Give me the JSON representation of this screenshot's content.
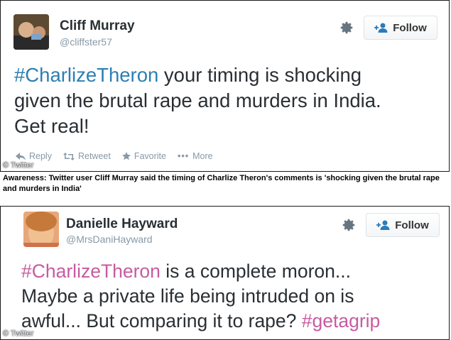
{
  "tweet1": {
    "name": "Cliff Murray",
    "handle": "@cliffster57",
    "follow_label": "Follow",
    "hashtag": "#CharlizeTheron",
    "text_line1_rest": " your timing is shocking",
    "text_line2": "given the brutal rape and murders in India.",
    "text_line3": "Get real!",
    "actions": {
      "reply": "Reply",
      "retweet": "Retweet",
      "favorite": "Favorite",
      "more": "More"
    },
    "credit": "© Twitter"
  },
  "caption": "Awareness: Twitter user Cliff Murray said the timing of Charlize Theron's comments is 'shocking given the brutal rape and murders in India'",
  "tweet2": {
    "name": "Danielle Hayward",
    "handle": "@MrsDaniHayward",
    "follow_label": "Follow",
    "hashtag": "#CharlizeTheron",
    "text_line1_rest": " is a complete moron...",
    "text_line2": "Maybe a private life being intruded on is",
    "text_line3_start": "awful... But comparing it to rape? ",
    "hashtag2": "#getagrip",
    "credit": "© Twitter"
  },
  "colors": {
    "hashtag1": "#2c7fb3",
    "hashtag2": "#c75c9e",
    "name": "#292f33",
    "muted": "#8899a6"
  }
}
